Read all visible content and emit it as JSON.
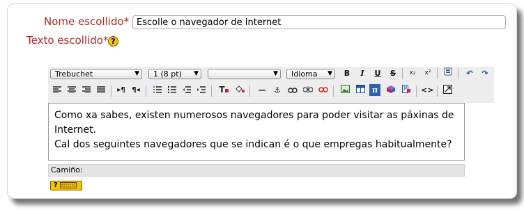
{
  "form": {
    "name_label": "Nome escollido*",
    "name_value": "Escolle o navegador de Internet",
    "text_label": "Texto escollido*",
    "help_glyph": "?"
  },
  "editor": {
    "font_family": "Trebuchet",
    "font_size": "1 (8 pt)",
    "style_select": "",
    "language": "Idioma",
    "lines": [
      "Como xa sabes, existen numerosos navegadores para poder visitar as páxinas de",
      "Internet.",
      "Cal dos seguintes navegadores que se indican é o que empregas habitualmente?"
    ],
    "path_label": "Camiño:"
  },
  "icons": {
    "bold": "B",
    "italic": "I",
    "underline": "U",
    "strike": "S",
    "sub": "x₂",
    "sup": "x²",
    "undo": "↶",
    "redo": "↷",
    "hr": "—",
    "anchor": "⚓",
    "source": "<>",
    "fullscreen": "⤢"
  },
  "colors": {
    "label_red": "#b3261e",
    "help_yellow": "#f7c600"
  }
}
